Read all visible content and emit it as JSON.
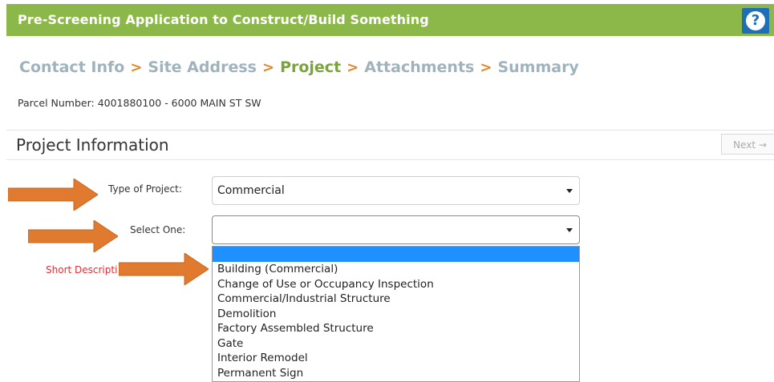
{
  "header": {
    "title": "Pre-Screening Application to Construct/Build Something",
    "help_icon": "question-mark-icon",
    "help_glyph": "?"
  },
  "breadcrumbs": {
    "steps": [
      "Contact Info",
      "Site Address",
      "Project",
      "Attachments",
      "Summary"
    ],
    "active": "Project",
    "separator": ">"
  },
  "parcel": {
    "text": "Parcel Number: 4001880100 - 6000 MAIN ST SW"
  },
  "section": {
    "title": "Project Information",
    "next_label": "Next →"
  },
  "form": {
    "type_label": "Type of Project:",
    "type_value": "Commercial",
    "select_one_label": "Select One:",
    "select_one_value": "",
    "short_description_label": "Short Descripti"
  },
  "dropdown": {
    "highlighted_option": "",
    "options": [
      "Building (Commercial)",
      "Change of Use or Occupancy Inspection",
      "Commercial/Industrial Structure",
      "Demolition",
      "Factory Assembled Structure",
      "Gate",
      "Interior Remodel",
      "Permanent Sign"
    ]
  },
  "colors": {
    "header_bg": "#8cb84a",
    "help_bg": "#1f6fb8",
    "active_step": "#7aa43a",
    "inactive_step": "#9fb3be",
    "separator": "#e0882a",
    "required_label": "#d9343a",
    "highlight": "#1e90ff",
    "arrow": "#e07a2e"
  }
}
